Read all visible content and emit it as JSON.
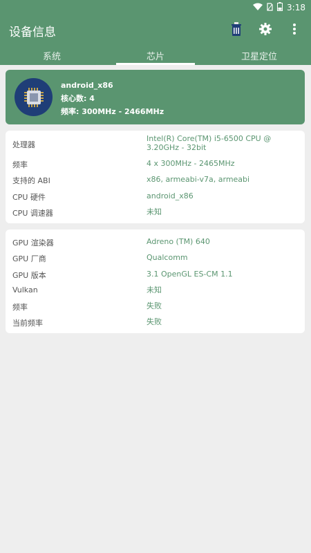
{
  "status_bar": {
    "time": "3:18"
  },
  "app_bar": {
    "title": "设备信息"
  },
  "tabs": [
    {
      "label": "系统"
    },
    {
      "label": "芯片"
    },
    {
      "label": "卫星定位"
    }
  ],
  "summary": {
    "name": "android_x86",
    "cores": "核心数: 4",
    "freq": "频率: 300MHz - 2466MHz"
  },
  "cpu_info": [
    {
      "key": "处理器",
      "value": "Intel(R) Core(TM) i5-6500 CPU @ 3.20GHz - 32bit"
    },
    {
      "key": "频率",
      "value": "4 x 300MHz - 2465MHz"
    },
    {
      "key": "支持的 ABI",
      "value": "x86, armeabi-v7a, armeabi"
    },
    {
      "key": "CPU 硬件",
      "value": "android_x86"
    },
    {
      "key": "CPU 调速器",
      "value": "未知"
    }
  ],
  "gpu_info": [
    {
      "key": "GPU 渲染器",
      "value": "Adreno (TM) 640"
    },
    {
      "key": "GPU 厂商",
      "value": "Qualcomm"
    },
    {
      "key": "GPU 版本",
      "value": "3.1 OpenGL ES-CM 1.1"
    },
    {
      "key": "Vulkan",
      "value": "未知"
    },
    {
      "key": "频率",
      "value": "失败"
    },
    {
      "key": "当前频率",
      "value": "失败"
    }
  ],
  "icons": [
    "wifi-icon",
    "sim-icon",
    "battery-icon",
    "clean-icon",
    "gear-icon",
    "more-vert-icon",
    "chip-icon"
  ],
  "colors": {
    "primary": "#5a9570",
    "badge": "#1f3e77",
    "background": "#eeeeee"
  }
}
